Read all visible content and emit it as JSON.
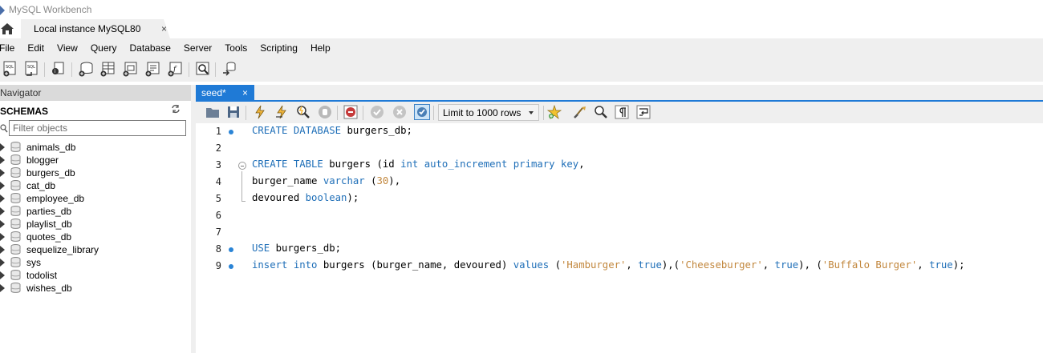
{
  "window": {
    "title": "MySQL Workbench"
  },
  "connection_tab": {
    "label": "Local instance MySQL80",
    "close": "×"
  },
  "menu": [
    "File",
    "Edit",
    "View",
    "Query",
    "Database",
    "Server",
    "Tools",
    "Scripting",
    "Help"
  ],
  "toolbar_icons": [
    "new-sql-tab-icon",
    "open-sql-script-icon",
    "inspector-icon",
    "create-schema-icon",
    "create-table-icon",
    "create-view-icon",
    "create-procedure-icon",
    "create-function-icon",
    "search-table-data-icon",
    "reconnect-icon"
  ],
  "navigator": {
    "header": "Navigator",
    "schemas_label": "SCHEMAS",
    "filter_placeholder": "Filter objects",
    "schemas": [
      "animals_db",
      "blogger",
      "burgers_db",
      "cat_db",
      "employee_db",
      "parties_db",
      "playlist_db",
      "quotes_db",
      "sequelize_library",
      "sys",
      "todolist",
      "wishes_db"
    ]
  },
  "editor_tab": {
    "label": "seed*",
    "close": "×"
  },
  "editor_toolbar": {
    "limit_select": "Limit to 1000 rows",
    "icons": [
      "open-file-icon",
      "save-icon",
      "execute-icon",
      "execute-current-icon",
      "explain-icon",
      "stop-icon",
      "toggle-error-icon",
      "commit-icon",
      "rollback-icon",
      "autocommit-icon",
      "add-snippet-icon",
      "beautify-icon",
      "find-icon",
      "invisible-chars-icon",
      "wrap-icon"
    ]
  },
  "code_lines": [
    {
      "num": "1",
      "dot": true,
      "fold": false,
      "parts": [
        [
          "kw",
          "CREATE DATABASE"
        ],
        [
          "",
          " burgers_db;"
        ]
      ]
    },
    {
      "num": "2",
      "dot": false,
      "fold": false,
      "parts": []
    },
    {
      "num": "3",
      "dot": false,
      "fold": true,
      "parts": [
        [
          "kw",
          "CREATE TABLE"
        ],
        [
          "",
          " burgers (id "
        ],
        [
          "kw",
          "int auto_increment primary key"
        ],
        [
          "",
          ","
        ]
      ]
    },
    {
      "num": "4",
      "dot": false,
      "fold": false,
      "parts": [
        [
          "",
          "burger_name "
        ],
        [
          "kw",
          "varchar"
        ],
        [
          "",
          " ("
        ],
        [
          "num",
          "30"
        ],
        [
          "",
          "),"
        ]
      ]
    },
    {
      "num": "5",
      "dot": false,
      "fold": false,
      "parts": [
        [
          "",
          "devoured "
        ],
        [
          "kw",
          "boolean"
        ],
        [
          "",
          ");"
        ]
      ]
    },
    {
      "num": "6",
      "dot": false,
      "fold": false,
      "parts": []
    },
    {
      "num": "7",
      "dot": false,
      "fold": false,
      "parts": []
    },
    {
      "num": "8",
      "dot": true,
      "fold": false,
      "parts": [
        [
          "kw",
          "USE"
        ],
        [
          "",
          " burgers_db;"
        ]
      ]
    },
    {
      "num": "9",
      "dot": true,
      "fold": false,
      "parts": [
        [
          "kw",
          "insert into"
        ],
        [
          "",
          " burgers (burger_name, devoured) "
        ],
        [
          "kw",
          "values"
        ],
        [
          "",
          " ("
        ],
        [
          "str",
          "'Hamburger'"
        ],
        [
          "",
          ", "
        ],
        [
          "kw",
          "true"
        ],
        [
          "",
          "),("
        ],
        [
          "str",
          "'Cheeseburger'"
        ],
        [
          "",
          ", "
        ],
        [
          "kw",
          "true"
        ],
        [
          "",
          "), ("
        ],
        [
          "str",
          "'Buffalo Burger'"
        ],
        [
          "",
          ", "
        ],
        [
          "kw",
          "true"
        ],
        [
          "",
          ");"
        ]
      ]
    }
  ],
  "colors": {
    "accent": "#1f7ad6",
    "keyword": "#1f6fb8",
    "string": "#c2873d",
    "chrome": "#efefef"
  }
}
